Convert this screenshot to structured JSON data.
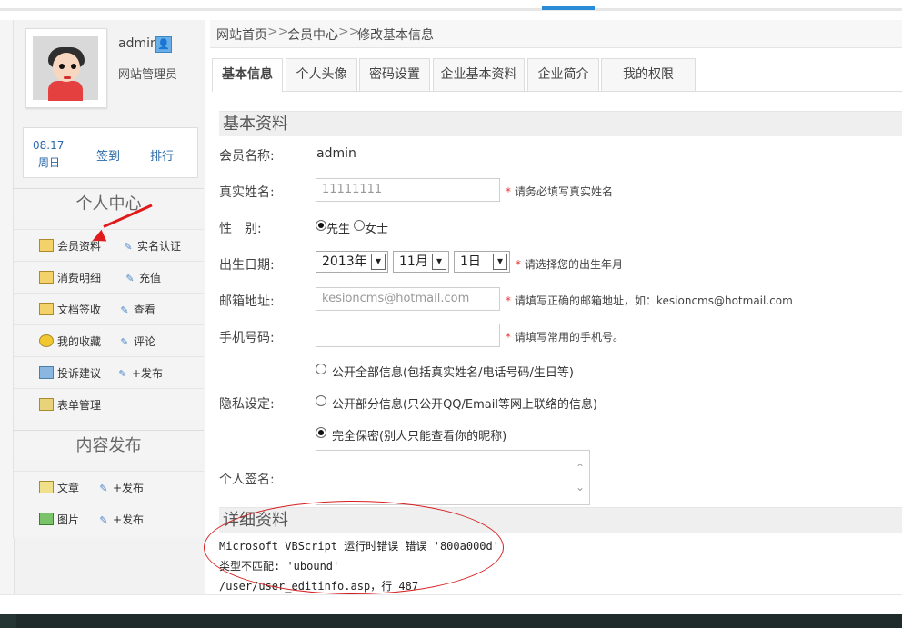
{
  "sidebar": {
    "username": "admin",
    "user_role": "网站管理员",
    "date_top": "08.17",
    "date_bottom": "周日",
    "sign_label": "签到",
    "rank_label": "排行",
    "personal_center_title": "个人中心",
    "content_publish_title": "内容发布",
    "menu_items": [
      {
        "left": "会员资料",
        "right": "实名认证"
      },
      {
        "left": "消费明细",
        "right": "充值"
      },
      {
        "left": "文档签收",
        "right": "查看"
      },
      {
        "left": "我的收藏",
        "right": "评论"
      },
      {
        "left": "投诉建议",
        "right": "+发布"
      },
      {
        "left": "表单管理",
        "right": ""
      }
    ],
    "publish_items": [
      {
        "left": "文章",
        "right": "+发布"
      },
      {
        "left": "图片",
        "right": "+发布"
      }
    ]
  },
  "breadcrumb": {
    "home": "网站首页",
    "sep1": ">>",
    "member_center": "会员中心",
    "sep2": ">>",
    "current": "修改基本信息"
  },
  "tabs": [
    "基本信息",
    "个人头像",
    "密码设置",
    "企业基本资料",
    "企业简介",
    "我的权限"
  ],
  "basic": {
    "title": "基本资料",
    "member_name_label": "会员名称:",
    "member_name_value": "admin",
    "real_name_label": "真实姓名:",
    "real_name_value": "11111111",
    "real_name_hint": "请务必填写真实姓名",
    "gender_label": "性　别:",
    "gender_male": "先生",
    "gender_female": "女士",
    "birthday_label": "出生日期:",
    "birthday_year": "2013年",
    "birthday_month": "11月",
    "birthday_day": "1日",
    "birthday_hint": "请选择您的出生年月",
    "email_label": "邮箱地址:",
    "email_value": "kesioncms@hotmail.com",
    "email_hint": "请填写正确的邮箱地址，如：kesioncms@hotmail.com",
    "mobile_label": "手机号码:",
    "mobile_hint": "请填写常用的手机号。",
    "privacy_label": "隐私设定:",
    "privacy_option1": "公开全部信息(包括真实姓名/电话号码/生日等)",
    "privacy_option2": "公开部分信息(只公开QQ/Email等网上联络的信息)",
    "privacy_option3": "完全保密(别人只能查看你的昵称)",
    "signature_label": "个人签名:"
  },
  "details": {
    "title": "详细资料",
    "error_line1": "Microsoft VBScript 运行时错误 错误 '800a000d'",
    "error_line2": "类型不匹配: 'ubound'",
    "error_line3": "/user/user_editinfo.asp，行 487"
  },
  "colors": {
    "accent_blue": "#2a8bd6",
    "error_red": "#d62020",
    "required_star": "#e23a3a"
  }
}
